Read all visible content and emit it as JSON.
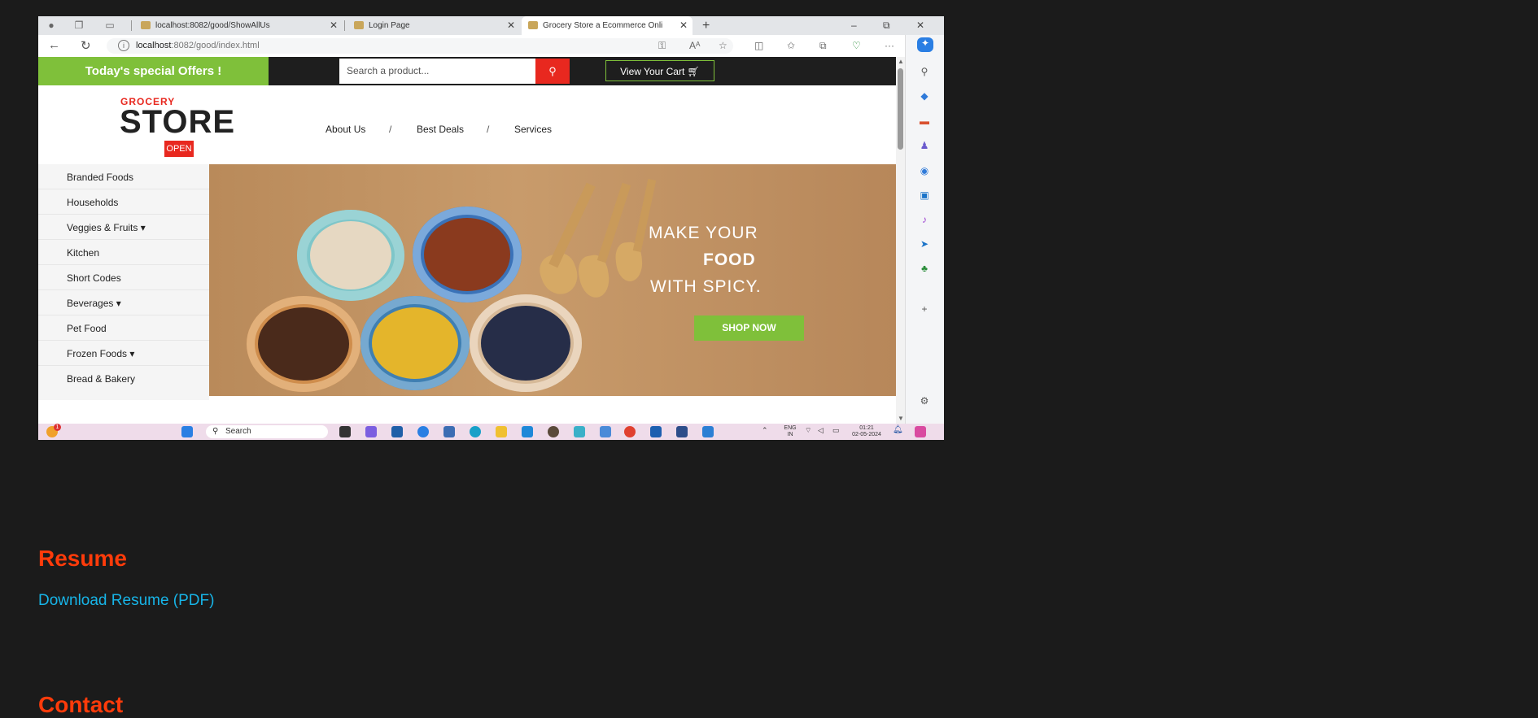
{
  "browser": {
    "tabs": [
      {
        "label": "localhost:8082/good/ShowAllUs",
        "active": false
      },
      {
        "label": "Login Page",
        "active": false
      },
      {
        "label": "Grocery Store a Ecommerce Onli",
        "active": true
      }
    ],
    "new_tab": "+",
    "window_controls": [
      "–",
      "⧉",
      "✕"
    ],
    "address": {
      "host": "localhost",
      "path": ":8082/good/index.html"
    }
  },
  "site": {
    "offers": "Today's special Offers !",
    "search_placeholder": "Search a product...",
    "cart": "View Your Cart",
    "logo": {
      "small": "GROCERY",
      "large": "STORE",
      "badge": "OPEN"
    },
    "menu": [
      "About Us",
      "Best Deals",
      "Services"
    ],
    "menu_separator": "/",
    "categories": [
      "Branded Foods",
      "Households",
      "Veggies & Fruits",
      "Kitchen",
      "Short Codes",
      "Beverages",
      "Pet Food",
      "Frozen Foods",
      "Bread & Bakery"
    ],
    "banner": {
      "line1": "MAKE YOUR",
      "line2": "FOOD",
      "line3": "WITH SPICY.",
      "button": "SHOP NOW"
    }
  },
  "taskbar": {
    "search": "Search",
    "notification_count": "1",
    "lang": "ENG",
    "region": "IN",
    "time": "01:21",
    "date": "02-05-2024"
  },
  "portfolio": {
    "resume_heading": "Resume",
    "resume_link": "Download Resume (PDF)",
    "contact_heading": "Contact"
  },
  "colors": {
    "accent_green": "#7fc03a",
    "accent_red": "#e8281f",
    "heading": "#ff3b0a",
    "link": "#17b5e8"
  }
}
